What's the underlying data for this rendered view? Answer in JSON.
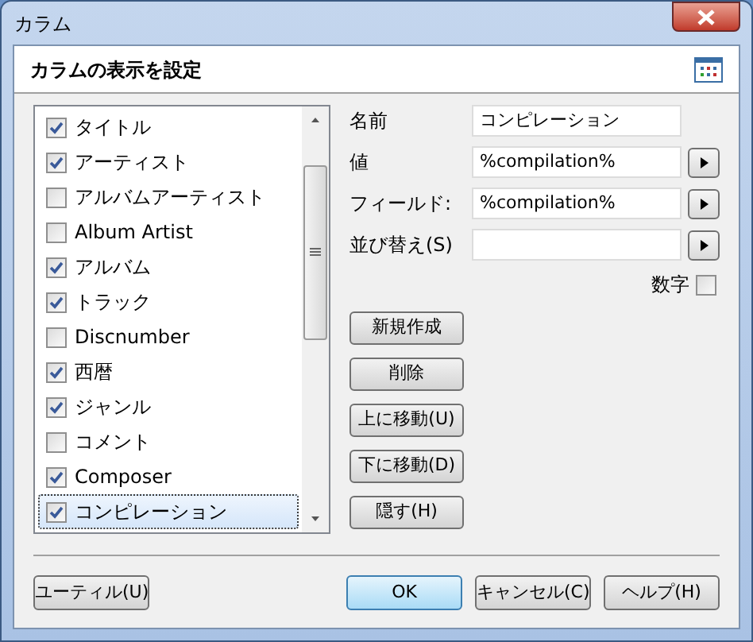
{
  "window": {
    "title": "カラム"
  },
  "header": {
    "title": "カラムの表示を設定"
  },
  "columns": [
    {
      "label": "タイトル",
      "checked": true,
      "selected": false
    },
    {
      "label": "アーティスト",
      "checked": true,
      "selected": false
    },
    {
      "label": "アルバムアーティスト",
      "checked": false,
      "selected": false
    },
    {
      "label": "Album Artist",
      "checked": false,
      "selected": false
    },
    {
      "label": "アルバム",
      "checked": true,
      "selected": false
    },
    {
      "label": "トラック",
      "checked": true,
      "selected": false
    },
    {
      "label": "Discnumber",
      "checked": false,
      "selected": false
    },
    {
      "label": "西暦",
      "checked": true,
      "selected": false
    },
    {
      "label": "ジャンル",
      "checked": true,
      "selected": false
    },
    {
      "label": "コメント",
      "checked": false,
      "selected": false
    },
    {
      "label": "Composer",
      "checked": true,
      "selected": false
    },
    {
      "label": "コンピレーション",
      "checked": true,
      "selected": true
    }
  ],
  "fields": [
    {
      "label": "名前",
      "value": "コンピレーション",
      "has_menu": false
    },
    {
      "label": "値",
      "value": "%compilation%",
      "has_menu": true
    },
    {
      "label": "フィールド:",
      "value": "%compilation%",
      "has_menu": true
    },
    {
      "label": "並び替え(S)",
      "has_menu": true
    }
  ],
  "numeric": {
    "label": "数字",
    "checked": false
  },
  "actions": [
    "新規作成",
    "削除",
    "上に移動(U)",
    "下に移動(D)",
    "隠す(H)"
  ],
  "buttons": [
    {
      "label": "ユーティル(U)",
      "default": false
    },
    {
      "label": "OK",
      "default": true
    },
    {
      "label": "キャンセル(C)",
      "default": false
    },
    {
      "label": "ヘルプ(H)",
      "default": false
    }
  ]
}
